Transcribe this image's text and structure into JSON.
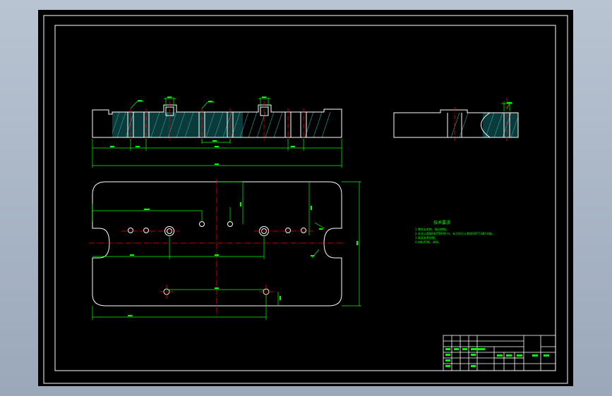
{
  "drawing": {
    "background_color": "#000000",
    "viewport_border_color": "#ffffff",
    "line_color": "#ffffff",
    "dimension_color": "#00ff00",
    "centerline_color": "#ff0000",
    "hatch_color": "#00aaaa"
  },
  "technical_requirements": {
    "title": "技术要求",
    "lines": [
      "1.零件去毛刺、锐边倒角。",
      "2.未注公差按GB/T1804-m，未注形位公差按GB/T1184-K级。",
      "3.表面发黑处理。",
      "4.材料45钢，调质。"
    ]
  },
  "title_block": {
    "cells": [
      "",
      "",
      "",
      "",
      "",
      "",
      "",
      ""
    ]
  }
}
